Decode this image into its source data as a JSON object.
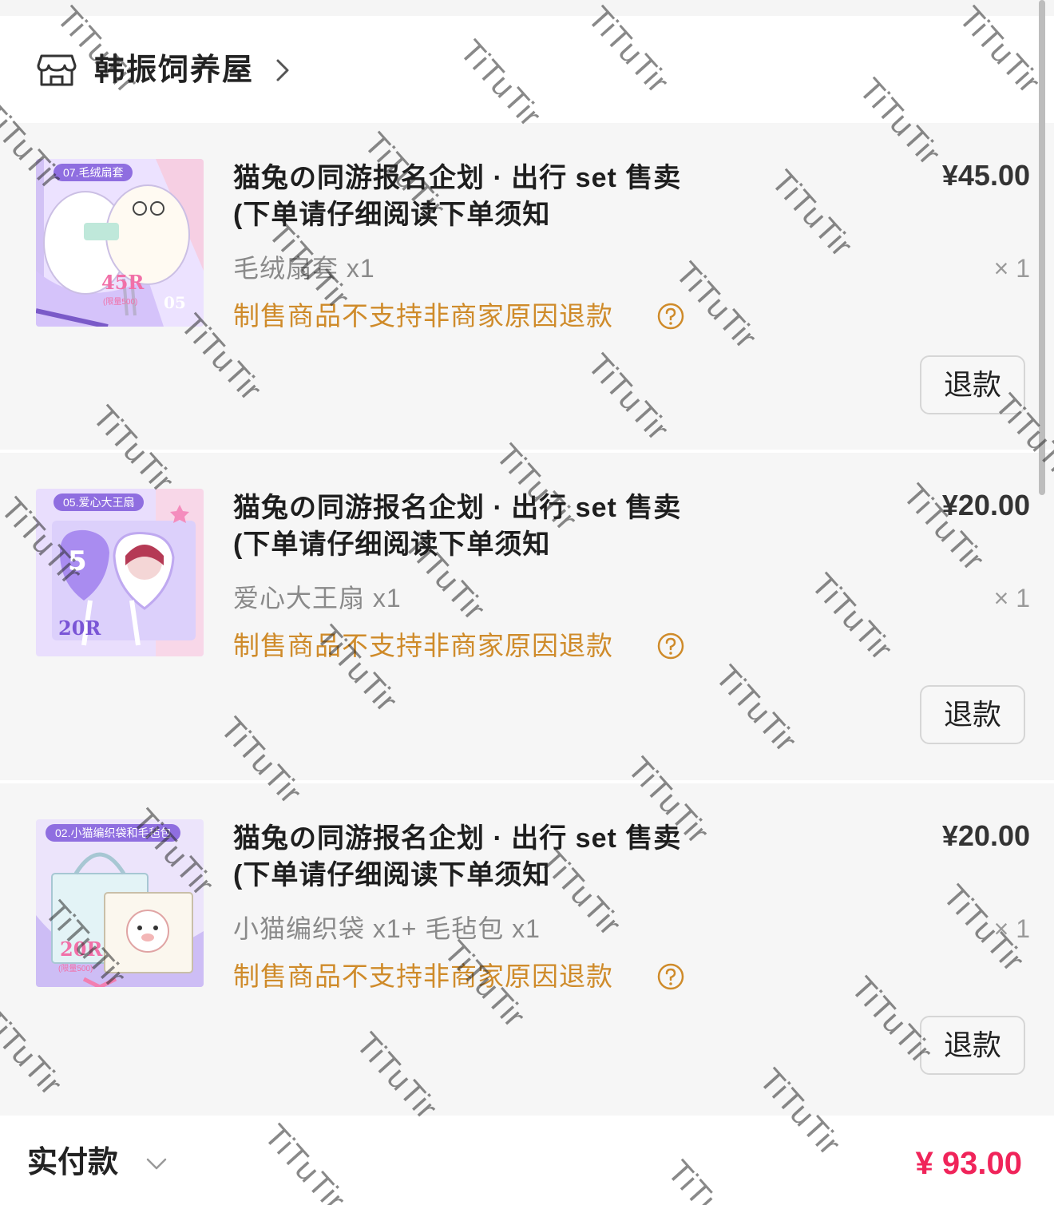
{
  "shop": {
    "name": "韩振饲养屋"
  },
  "items": [
    {
      "title_line1": "猫兔の同游报名企划 · 出行 set 售卖",
      "title_line2": "(下单请仔细阅读下单须知",
      "variant": "毛绒扇套 x1",
      "notice": "制售商品不支持非商家原因退款",
      "price": "¥45.00",
      "qty": "× 1",
      "refund_label": "退款",
      "thumb": {
        "tag": "07.毛绒扇套",
        "price": "45R",
        "limit": "(限量500)",
        "corner": "05",
        "bg": "#e9dcff",
        "accent": "#8f6ee0"
      }
    },
    {
      "title_line1": "猫兔の同游报名企划 · 出行 set 售卖",
      "title_line2": "(下单请仔细阅读下单须知",
      "variant": "爱心大王扇 x1",
      "notice": "制售商品不支持非商家原因退款",
      "price": "¥20.00",
      "qty": "× 1",
      "refund_label": "退款",
      "thumb": {
        "tag": "05.爱心大王扇",
        "price": "20R",
        "bg": "#e7dcfb",
        "accent": "#8f6ee0"
      }
    },
    {
      "title_line1": "猫兔の同游报名企划 · 出行 set 售卖",
      "title_line2": "(下单请仔细阅读下单须知",
      "variant": "小猫编织袋 x1+ 毛毡包 x1",
      "notice": "制售商品不支持非商家原因退款",
      "price": "¥20.00",
      "qty": "× 1",
      "refund_label": "退款",
      "thumb": {
        "tag": "02.小猫编织袋和毛毡包",
        "price": "20R",
        "limit": "(限量500)",
        "bg": "#e6ddfa",
        "accent": "#8f6ee0"
      }
    }
  ],
  "footer": {
    "label": "实付款",
    "amount": "¥ 93.00"
  },
  "watermark": "TiTuTir",
  "colors": {
    "notice": "#cf8b2a",
    "total": "#f0245a",
    "thumb_accent": "#8f6ee0"
  }
}
